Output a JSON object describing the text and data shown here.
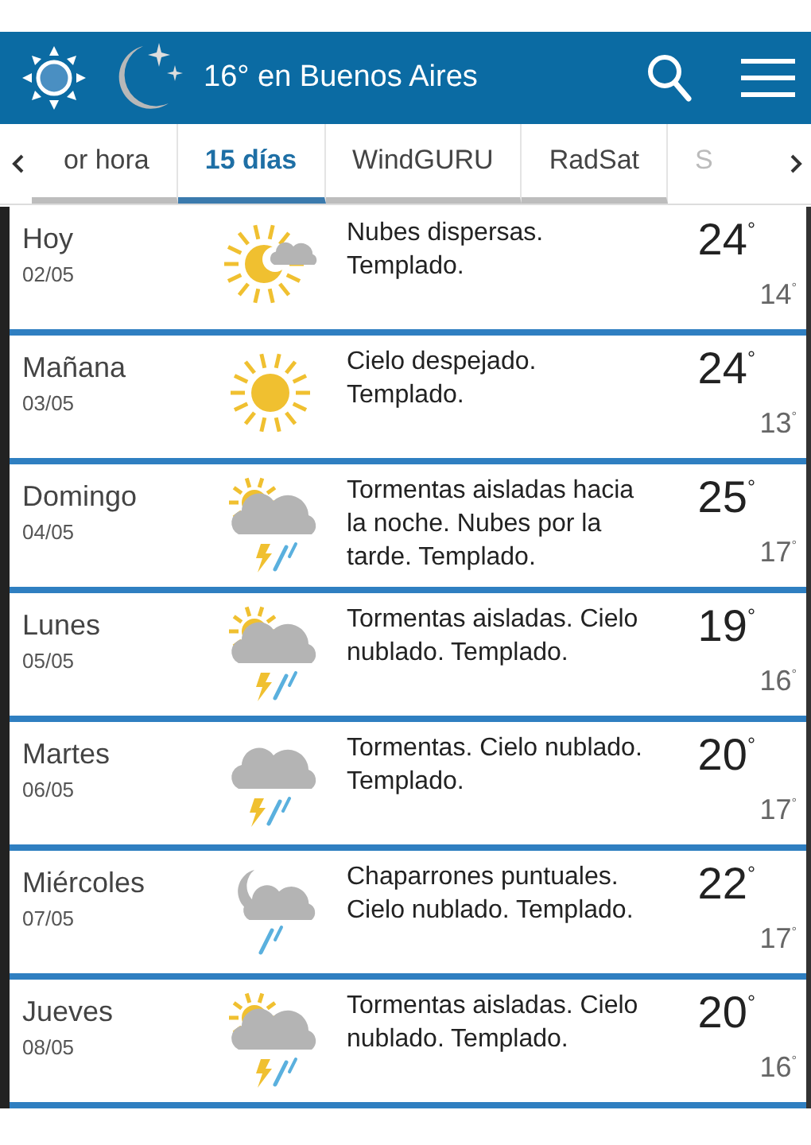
{
  "header": {
    "title": "16° en Buenos Aires"
  },
  "tabs": [
    {
      "label": "or hora",
      "selected": false
    },
    {
      "label": "15 días",
      "selected": true
    },
    {
      "label": "WindGURU",
      "selected": false
    },
    {
      "label": "RadSat",
      "selected": false
    },
    {
      "label": "S",
      "selected": false
    }
  ],
  "days": [
    {
      "day": "Hoy",
      "date": "02/05",
      "kind": "partly",
      "description": "Nubes dispersas. Templado.",
      "high": "24$^{°}$",
      "low": "14$^{°}$"
    },
    {
      "day": "Mañana",
      "date": "03/05",
      "kind": "clear",
      "description": "Cielo despejado. Templado.",
      "high": "24$^{°}$",
      "low": "13$^{°}$"
    },
    {
      "day": "Domingo",
      "date": "04/05",
      "kind": "sunstorm",
      "description": "Tormentas aisladas hacia la noche. Nubes por la tarde. Templado.",
      "high": "25$^{°}$",
      "low": "17$^{°}$"
    },
    {
      "day": "Lunes",
      "date": "05/05",
      "kind": "sunstorm",
      "description": "Tormentas aisladas. Cielo nublado. Templado.",
      "high": "19$^{°}$",
      "low": "16$^{°}$"
    },
    {
      "day": "Martes",
      "date": "06/05",
      "kind": "storm",
      "description": "Tormentas. Cielo nublado. Templado.",
      "high": "20$^{°}$",
      "low": "17$^{°}$"
    },
    {
      "day": "Miércoles",
      "date": "07/05",
      "kind": "nightrain",
      "description": "Chaparrones puntuales. Cielo nublado. Templado.",
      "high": "22$^{°}$",
      "low": "17$^{°}$"
    },
    {
      "day": "Jueves",
      "date": "08/05",
      "kind": "sunstorm",
      "description": "Tormentas aisladas. Cielo nublado. Templado.",
      "high": "20$^{°}$",
      "low": "16$^{°}$"
    }
  ]
}
